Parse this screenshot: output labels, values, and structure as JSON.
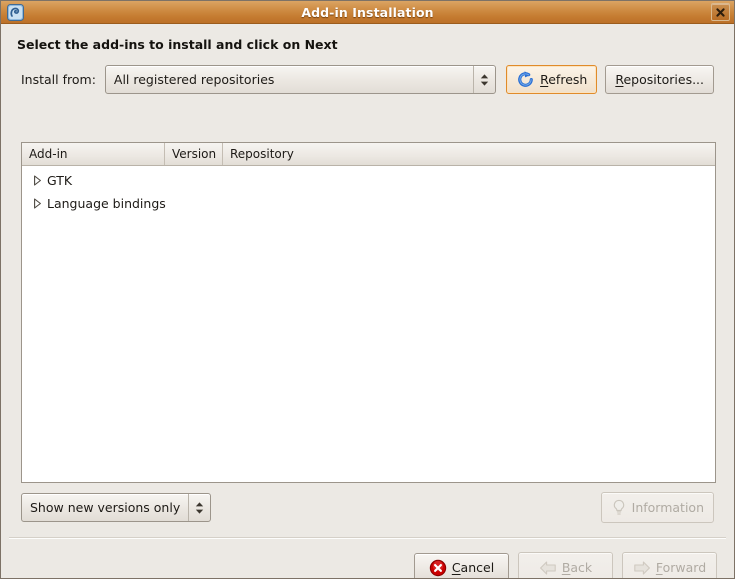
{
  "window": {
    "title": "Add-in Installation",
    "app_icon": "monodevelop-addin-icon",
    "close_label": "x",
    "close_icon": "close-icon"
  },
  "headline": "Select the add-ins to install and click on Next",
  "install_from": {
    "label": "Install from:",
    "selected": "All registered repositories",
    "options": [
      "All registered repositories"
    ],
    "arrow_icon": "up-down-chevron-icon"
  },
  "toolbar": {
    "refresh": {
      "label_pre": "",
      "accel": "R",
      "label_post": "efresh",
      "icon": "refresh-circular-arrow-icon",
      "focused": true,
      "disabled": false
    },
    "repositories": {
      "label_pre": "",
      "accel": "R",
      "label_post": "epositories...",
      "disabled": false
    }
  },
  "tree": {
    "columns": [
      "Add-in",
      "Version",
      "Repository"
    ],
    "rows": [
      {
        "label": "GTK",
        "version": "",
        "repository": "",
        "expander": "triangle-right-icon"
      },
      {
        "label": "Language bindings",
        "version": "",
        "repository": "",
        "expander": "triangle-right-icon"
      }
    ]
  },
  "filter": {
    "selected": "Show new versions only",
    "options": [
      "Show new versions only"
    ],
    "arrow_icon": "up-down-chevron-icon"
  },
  "information_button": {
    "label": "Information",
    "icon": "lightbulb-icon",
    "disabled": true
  },
  "actions": {
    "cancel": {
      "label_pre": "",
      "accel": "C",
      "label_post": "ancel",
      "icon": "cancel-red-x-icon",
      "disabled": false
    },
    "back": {
      "label_pre": "",
      "accel": "B",
      "label_post": "ack",
      "icon": "arrow-left-icon",
      "disabled": true
    },
    "forward": {
      "label_pre": "",
      "accel": "F",
      "label_post": "orward",
      "icon": "arrow-right-icon",
      "disabled": true
    }
  },
  "colors": {
    "titlebar_top": "#dba463",
    "titlebar_bottom": "#bc7028",
    "dialog_bg": "#ece9e4",
    "focus_accent": "#e08b2a",
    "list_bg": "#ffffff",
    "cancel_red": "#cc0000",
    "refresh_blue": "#2a6fd4"
  }
}
